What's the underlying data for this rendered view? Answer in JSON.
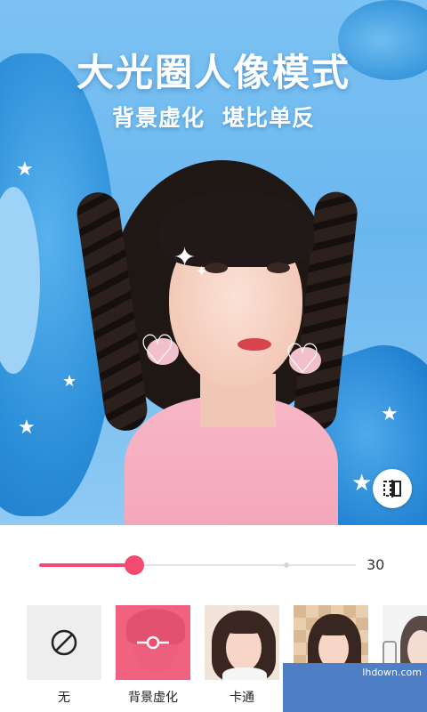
{
  "hero": {
    "title": "大光圈人像模式",
    "subtitle_left": "背景虚化",
    "subtitle_right": "堪比单反"
  },
  "slider": {
    "value": 30,
    "max": 100,
    "tick_mark": 78,
    "accent_color": "#f34b70"
  },
  "effects": [
    {
      "label": "无",
      "icon": "none-circle-slash-icon",
      "selected": false
    },
    {
      "label": "背景虚化",
      "icon": "blur-adjust-icon",
      "selected": true
    },
    {
      "label": "卡通",
      "selected": false
    },
    {
      "label": "",
      "selected": false
    },
    {
      "label": "",
      "selected": false
    }
  ],
  "compare_button": {
    "icon": "compare-split-icon"
  },
  "watermark": {
    "text": "lhdown.com"
  }
}
